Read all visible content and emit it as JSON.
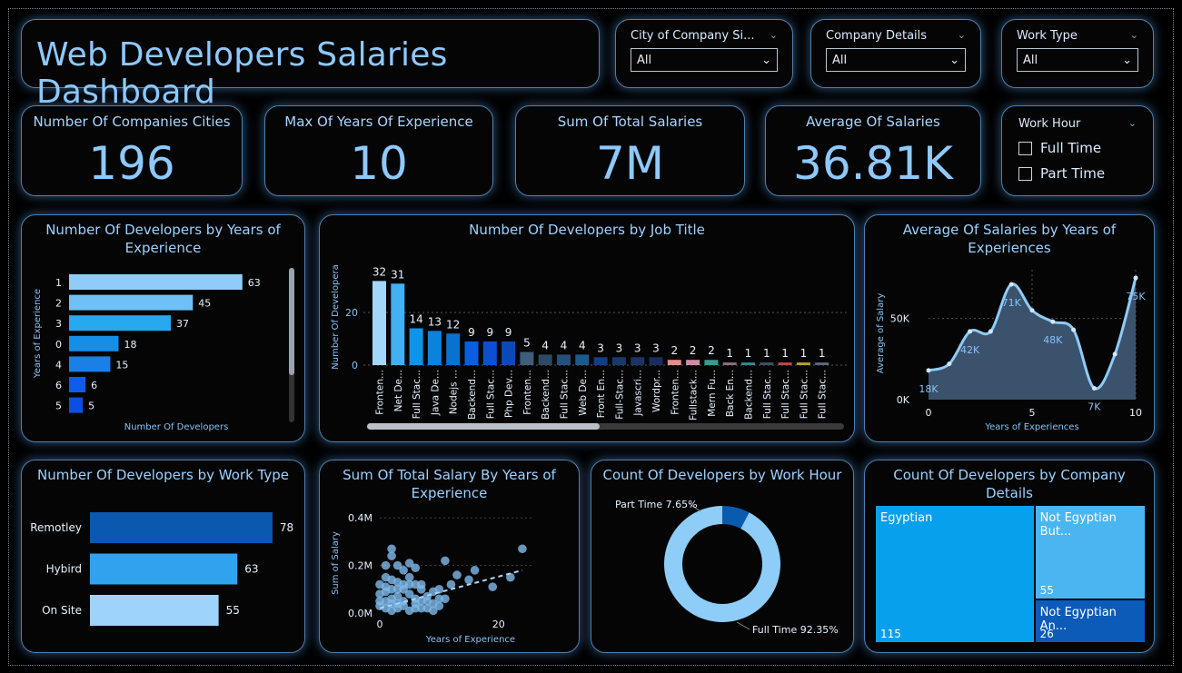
{
  "title": "Web Developers Salaries Dashboard",
  "slicers": {
    "city": {
      "label": "City of Company Si...",
      "value": "All"
    },
    "company": {
      "label": "Company Details",
      "value": "All"
    },
    "worktype": {
      "label": "Work Type",
      "value": "All"
    },
    "workhour": {
      "label": "Work Hour",
      "options": [
        "Full Time",
        "Part Time"
      ]
    }
  },
  "kpis": {
    "cities": {
      "label": "Number Of Companies Cities",
      "value": "196"
    },
    "maxyears": {
      "label": "Max Of Years Of Experience",
      "value": "10"
    },
    "totalsal": {
      "label": "Sum Of Total Salaries",
      "value": "7M"
    },
    "avgsal": {
      "label": "Average Of Salaries",
      "value": "36.81K"
    }
  },
  "colors": {
    "accent": "#8ec9ff",
    "card_border": "#4d7fb0",
    "bg": "#000000"
  },
  "chart_data": [
    {
      "id": "dev_by_years",
      "type": "bar",
      "orientation": "horizontal",
      "title": "Number Of Developers by Years of Experience",
      "xlabel": "Number Of Developers",
      "ylabel": "Years of Experience",
      "categories": [
        "1",
        "2",
        "3",
        "0",
        "4",
        "6",
        "5"
      ],
      "values": [
        63,
        45,
        37,
        18,
        15,
        6,
        5
      ],
      "colors": [
        "#8fcdf8",
        "#6ec0f6",
        "#26a9ee",
        "#148ee6",
        "#1a7fe6",
        "#0d5de8",
        "#0a4fe0"
      ],
      "xlim": [
        0,
        70
      ]
    },
    {
      "id": "dev_by_job",
      "type": "bar",
      "title": "Number Of Developers by Job Title",
      "ylabel": "Number Of Developera",
      "categories": [
        "Fronten...",
        "Net De...",
        "Full Stac...",
        "Java De...",
        "Nodejs ...",
        "Backend...",
        "Full Stac...",
        "Php Dev...",
        "Fronten...",
        "Backend...",
        "Full Stac...",
        "Web De...",
        "Front En...",
        "Full-Stac...",
        "Javascri...",
        "Wordpr...",
        "Fronten...",
        "Fullstack...",
        "Mern Fu...",
        "Back En...",
        "Backend...",
        "Full Stac...",
        "Full Stac...",
        "Full Stac...",
        "Full Stac..."
      ],
      "values": [
        32,
        31,
        14,
        13,
        12,
        9,
        9,
        9,
        5,
        4,
        4,
        4,
        3,
        3,
        3,
        3,
        2,
        2,
        2,
        1,
        1,
        1,
        1,
        1,
        1
      ],
      "colors": [
        "#a3d6fb",
        "#42b0f1",
        "#0f95e8",
        "#0b83dc",
        "#0772d0",
        "#0a5ee0",
        "#0c4fd0",
        "#0c49b8",
        "#3e5e7a",
        "#2c4a66",
        "#22507a",
        "#1d5a8c",
        "#13407a",
        "#173a6c",
        "#1b3466",
        "#1a2e5e",
        "#e58c8c",
        "#d18aa8",
        "#3c9a8a",
        "#8a6f84",
        "#2a8f92",
        "#3f5264",
        "#c8424e",
        "#b69f2a",
        "#5a6a7a"
      ],
      "yticks": [
        0,
        20
      ],
      "ylim": [
        0,
        38
      ]
    },
    {
      "id": "avg_by_years",
      "type": "area",
      "title": "Average Of Salaries by Years of Experiences",
      "xlabel": "Years of Experiences",
      "ylabel": "Average of Salary",
      "x": [
        0,
        1,
        2,
        3,
        4,
        5,
        6,
        7,
        8,
        9,
        10
      ],
      "y": [
        18,
        22,
        42,
        42,
        71,
        55,
        48,
        43,
        7,
        28,
        75
      ],
      "point_labels": [
        {
          "x": 0,
          "label": "18K"
        },
        {
          "x": 2,
          "label": "42K"
        },
        {
          "x": 4,
          "label": "71K"
        },
        {
          "x": 6,
          "label": "48K"
        },
        {
          "x": 8,
          "label": "7K"
        },
        {
          "x": 10,
          "label": "75K"
        }
      ],
      "xticks": [
        "0",
        "5",
        "10"
      ],
      "yticks": [
        "0K",
        "50K"
      ],
      "ylim": [
        0,
        80
      ],
      "xlim": [
        0,
        10
      ]
    },
    {
      "id": "dev_by_worktype",
      "type": "bar",
      "orientation": "horizontal",
      "title": "Number Of Developers by Work Type",
      "categories": [
        "Remotley",
        "Hybird",
        "On Site"
      ],
      "values": [
        78,
        63,
        55
      ],
      "colors": [
        "#0a58b0",
        "#31a3ee",
        "#9ed3fb"
      ],
      "xlim": [
        0,
        80
      ]
    },
    {
      "id": "salary_scatter",
      "type": "scatter",
      "title": "Sum Of Total Salary By Years of Experience",
      "xlabel": "Years of Experience",
      "ylabel": "Sum of Salary",
      "xticks": [
        "0",
        "20"
      ],
      "yticks": [
        "0.0M",
        "0.2M",
        "0.4M"
      ],
      "xlim": [
        0,
        26
      ],
      "ylim": [
        0,
        0.42
      ],
      "points": [
        [
          2,
          0.27
        ],
        [
          2,
          0.24
        ],
        [
          1,
          0.2
        ],
        [
          3,
          0.2
        ],
        [
          5,
          0.21
        ],
        [
          4,
          0.18
        ],
        [
          1,
          0.15
        ],
        [
          2,
          0.14
        ],
        [
          3,
          0.13
        ],
        [
          5,
          0.15
        ],
        [
          6,
          0.12
        ],
        [
          7,
          0.12
        ],
        [
          6,
          0.19
        ],
        [
          11,
          0.22
        ],
        [
          13,
          0.16
        ],
        [
          16,
          0.18
        ],
        [
          15,
          0.14
        ],
        [
          12,
          0.12
        ],
        [
          10,
          0.1
        ],
        [
          11,
          0.06
        ],
        [
          24,
          0.27
        ],
        [
          22,
          0.15
        ],
        [
          19,
          0.11
        ],
        [
          0,
          0.08
        ],
        [
          1,
          0.09
        ],
        [
          2,
          0.06
        ],
        [
          3,
          0.07
        ],
        [
          4,
          0.05
        ],
        [
          5,
          0.08
        ],
        [
          6,
          0.06
        ],
        [
          7,
          0.1
        ],
        [
          8,
          0.07
        ],
        [
          9,
          0.09
        ],
        [
          0,
          0.03
        ],
        [
          1,
          0.02
        ],
        [
          2,
          0.04
        ],
        [
          3,
          0.02
        ],
        [
          4,
          0.03
        ],
        [
          5,
          0.01
        ],
        [
          6,
          0.04
        ],
        [
          7,
          0.02
        ],
        [
          8,
          0.05
        ],
        [
          9,
          0.04
        ],
        [
          0,
          0.05
        ],
        [
          1,
          0.05
        ],
        [
          2,
          0.01
        ],
        [
          3,
          0.04
        ],
        [
          4,
          0.1
        ],
        [
          5,
          0.12
        ],
        [
          6,
          0.02
        ],
        [
          8,
          0.02
        ],
        [
          9,
          0.01
        ],
        [
          10,
          0.03
        ],
        [
          1,
          0.11
        ],
        [
          2,
          0.1
        ],
        [
          3,
          0.1
        ],
        [
          4,
          0.12
        ],
        [
          0,
          0.12
        ],
        [
          7,
          0.05
        ],
        [
          10,
          0.06
        ]
      ],
      "trend": [
        [
          0,
          0.02
        ],
        [
          24,
          0.18
        ]
      ]
    },
    {
      "id": "dev_by_workhour",
      "type": "pie",
      "donut": true,
      "title": "Count Of Developers by Work Hour",
      "slices": [
        {
          "label": "Part Time 7.65%",
          "value": 7.65,
          "color": "#0a5ab0"
        },
        {
          "label": "Full Time 92.35%",
          "value": 92.35,
          "color": "#8ecdf8"
        }
      ]
    },
    {
      "id": "dev_by_company",
      "type": "treemap",
      "title": "Count Of Developers by Company Details",
      "items": [
        {
          "label": "Egyptian",
          "value": 115,
          "color": "#07a0ec"
        },
        {
          "label": "Not Egyptian But...",
          "value": 55,
          "color": "#49b6f2"
        },
        {
          "label": "Not Egyptian An...",
          "value": 26,
          "color": "#0c5bb8"
        }
      ]
    }
  ]
}
